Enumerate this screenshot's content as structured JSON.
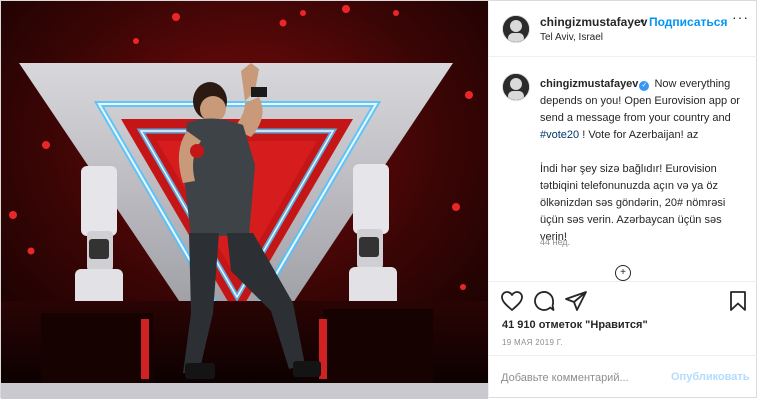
{
  "post": {
    "username": "chingizmustafayev",
    "follow_label": "Подписаться",
    "dot": "•",
    "location": "Tel Aviv, Israel",
    "more": "···",
    "caption": {
      "username": "chingizmustafayev",
      "verified": "✓",
      "text_before_tag": " Now everything depends on you! Open Eurovision app or send a message from your country and ",
      "hashtag": "#vote20",
      "text_after_tag": " ! Vote for Azerbaijan! az",
      "paragraph2": "İndi hər şey sizə bağlıdır! Eurovision tətbiqini telefonunuzda açın və ya öz ölkənizdən səs göndərin, 20# nömrəsi üçün səs verin. Azərbaycan üçün səs verin!"
    },
    "time_ago": "44 нед.",
    "load_more": "+",
    "likes": "41 910 отметок \"Нравится\"",
    "date": "19 МАЯ 2019 Г.",
    "comment_placeholder": "Добавьте комментарий...",
    "publish_label": "Опубликовать"
  },
  "icons": {
    "like": "heart-icon",
    "comment": "comment-icon",
    "share": "paper-plane-icon",
    "save": "bookmark-icon",
    "verified": "verified-badge-icon"
  },
  "colors": {
    "link_blue": "#0095f6",
    "publish_disabled": "#b3dbff",
    "verified": "#3897f0",
    "stage_red": "#c41616",
    "neon_blue": "#4fc3ff"
  }
}
